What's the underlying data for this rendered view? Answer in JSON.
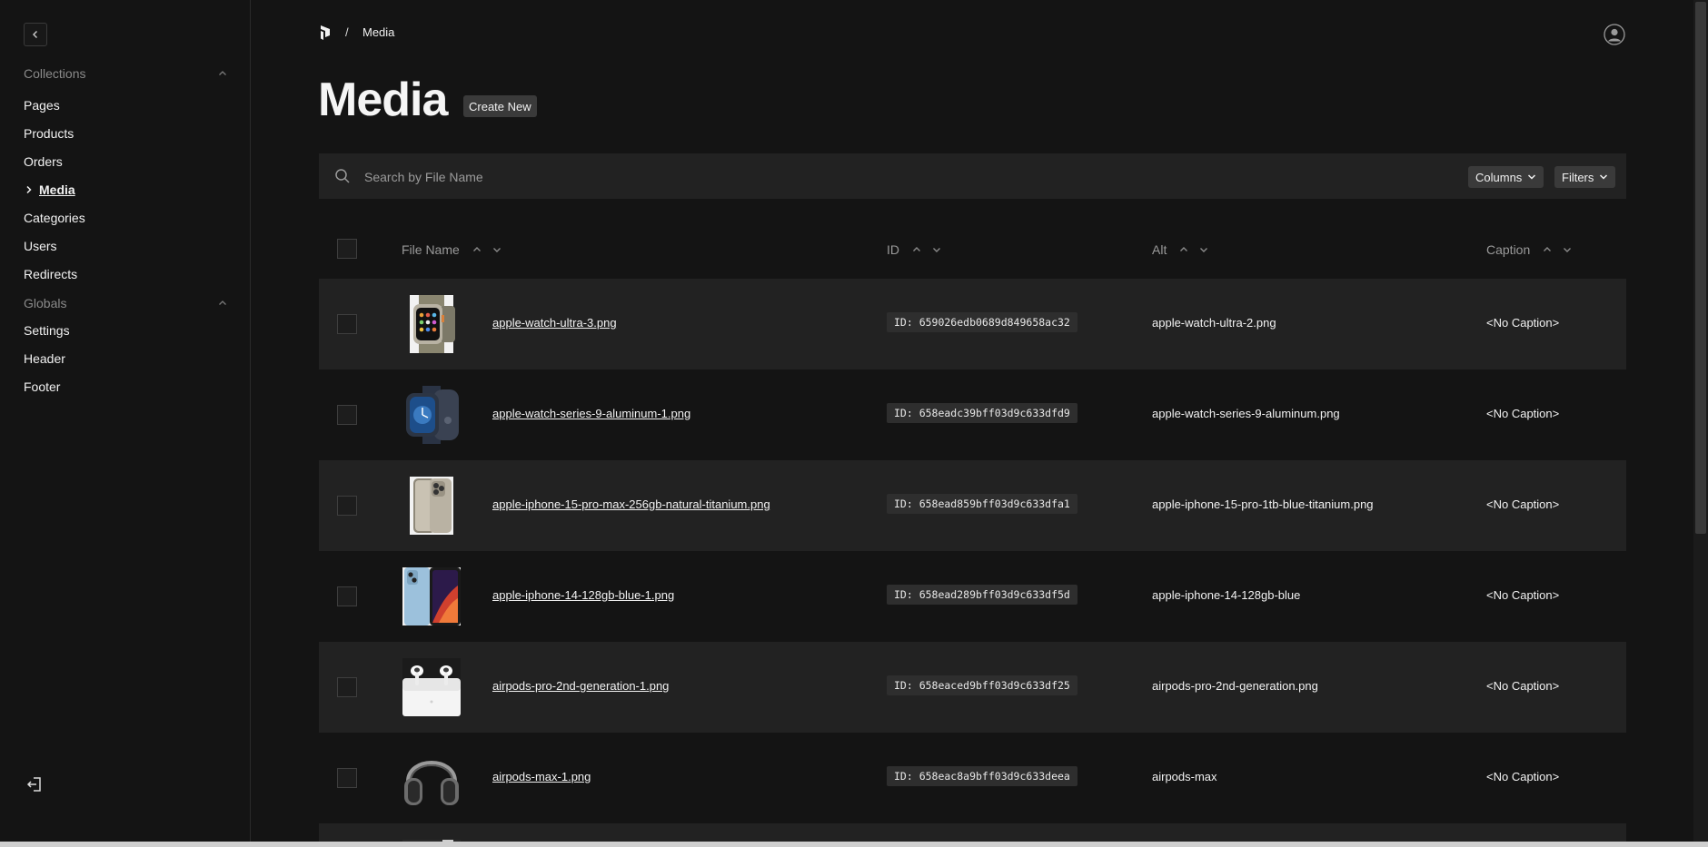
{
  "sidebar": {
    "groups": [
      {
        "title": "Collections",
        "items": [
          {
            "label": "Pages"
          },
          {
            "label": "Products"
          },
          {
            "label": "Orders"
          },
          {
            "label": "Media",
            "active": true
          },
          {
            "label": "Categories"
          },
          {
            "label": "Users"
          },
          {
            "label": "Redirects"
          }
        ]
      },
      {
        "title": "Globals",
        "items": [
          {
            "label": "Settings"
          },
          {
            "label": "Header"
          },
          {
            "label": "Footer"
          }
        ]
      }
    ]
  },
  "breadcrumb": {
    "separator": "/",
    "current": "Media"
  },
  "page": {
    "title": "Media",
    "create_label": "Create New"
  },
  "toolbar": {
    "search_placeholder": "Search by File Name",
    "columns_label": "Columns",
    "filters_label": "Filters"
  },
  "table": {
    "columns": [
      "File Name",
      "ID",
      "Alt",
      "Caption"
    ],
    "rows": [
      {
        "file": "apple-watch-ultra-3.png",
        "id": "ID: 659026edb0689d849658ac32",
        "alt": "apple-watch-ultra-2.png",
        "caption": "<No Caption>",
        "thumb": "watch-ultra"
      },
      {
        "file": "apple-watch-series-9-aluminum-1.png",
        "id": "ID: 658eadc39bff03d9c633dfd9",
        "alt": "apple-watch-series-9-aluminum.png",
        "caption": "<No Caption>",
        "thumb": "watch-series"
      },
      {
        "file": "apple-iphone-15-pro-max-256gb-natural-titanium.png",
        "id": "ID: 658ead859bff03d9c633dfa1",
        "alt": "apple-iphone-15-pro-1tb-blue-titanium.png",
        "caption": "<No Caption>",
        "thumb": "iphone-15"
      },
      {
        "file": "apple-iphone-14-128gb-blue-1.png",
        "id": "ID: 658ead289bff03d9c633df5d",
        "alt": "apple-iphone-14-128gb-blue",
        "caption": "<No Caption>",
        "thumb": "iphone-14"
      },
      {
        "file": "airpods-pro-2nd-generation-1.png",
        "id": "ID: 658eaced9bff03d9c633df25",
        "alt": "airpods-pro-2nd-generation.png",
        "caption": "<No Caption>",
        "thumb": "airpods-pro"
      },
      {
        "file": "airpods-max-1.png",
        "id": "ID: 658eac8a9bff03d9c633deea",
        "alt": "airpods-max",
        "caption": "<No Caption>",
        "thumb": "airpods-max"
      }
    ]
  }
}
